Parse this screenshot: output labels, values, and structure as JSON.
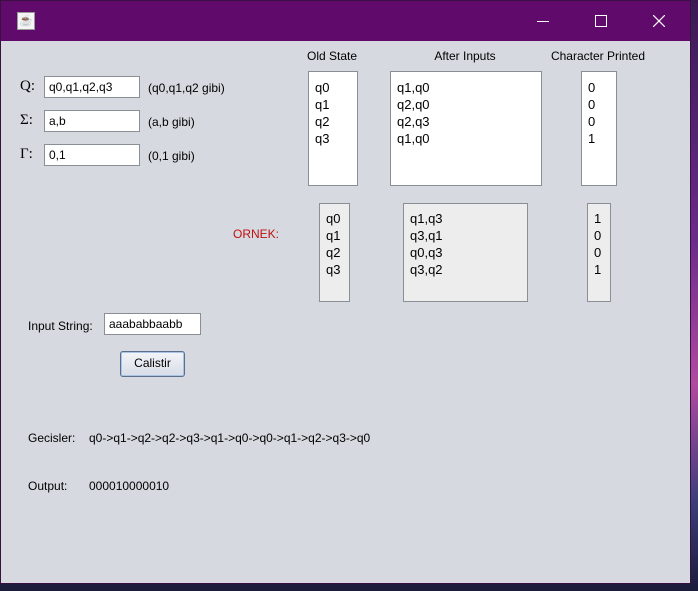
{
  "window": {
    "app_icon": "java-icon",
    "controls": {
      "minimize": "minimize-icon",
      "maximize": "maximize-icon",
      "close": "close-icon"
    }
  },
  "form": {
    "states": {
      "symbol": "Q:",
      "value": "q0,q1,q2,q3",
      "hint": "(q0,q1,q2 gibi)"
    },
    "input_alphabet": {
      "symbol": "Σ:",
      "value": "a,b",
      "hint": "(a,b gibi)"
    },
    "output_alphabet": {
      "symbol": "Γ:",
      "value": "0,1",
      "hint": "(0,1 gibi)"
    }
  },
  "table": {
    "headers": {
      "old_state": "Old State",
      "after_inputs": "After Inputs",
      "character_printed": "Character Printed"
    },
    "old_state": [
      "q0",
      "q1",
      "q2",
      "q3"
    ],
    "after_inputs": [
      "q1,q0",
      "q2,q0",
      "q2,q3",
      "q1,q0"
    ],
    "character_printed": [
      "0",
      "0",
      "0",
      "1"
    ]
  },
  "example": {
    "label": "ORNEK:",
    "old_state": [
      "q0",
      "q1",
      "q2",
      "q3"
    ],
    "after_inputs": [
      "q1,q3",
      "q3,q1",
      "q0,q3",
      "q3,q2"
    ],
    "character_printed": [
      "1",
      "0",
      "0",
      "1"
    ]
  },
  "input_string": {
    "label": "Input String:",
    "value": "aaababbaabb"
  },
  "run_button": {
    "label": "Calistir"
  },
  "result": {
    "transitions_label": "Gecisler:",
    "transitions_value": "q0->q1->q2->q2->q3->q1->q0->q0->q1->q2->q3->q0",
    "output_label": "Output:",
    "output_value": "000010000010"
  }
}
